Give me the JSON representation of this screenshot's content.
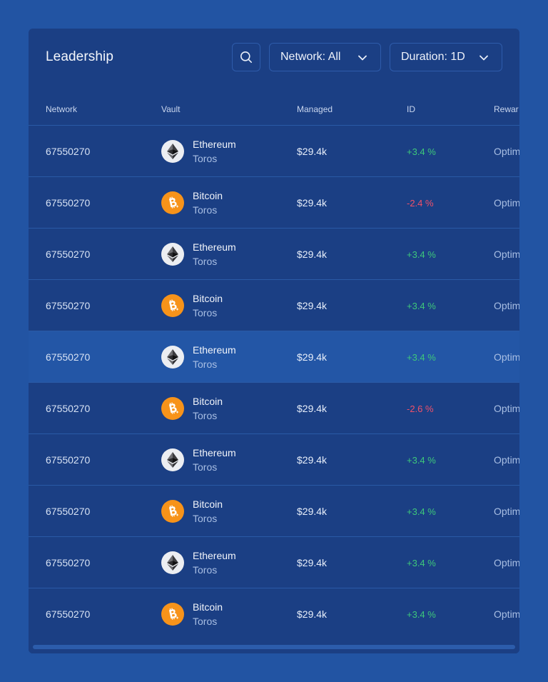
{
  "header": {
    "title": "Leadership",
    "network_filter": "Network: All",
    "duration_filter": "Duration: 1D"
  },
  "table": {
    "columns": [
      "Network",
      "Vault",
      "Managed",
      "ID",
      "Rewar"
    ],
    "rows": [
      {
        "network": "67550270",
        "coin": "eth",
        "name": "Ethereum",
        "sub": "Toros",
        "managed": "$29.4k",
        "change": "+3.4 %",
        "trend": "pos",
        "reward": "Optim"
      },
      {
        "network": "67550270",
        "coin": "btc",
        "name": "Bitcoin",
        "sub": "Toros",
        "managed": "$29.4k",
        "change": "-2.4 %",
        "trend": "neg",
        "reward": "Optim"
      },
      {
        "network": "67550270",
        "coin": "eth",
        "name": "Ethereum",
        "sub": "Toros",
        "managed": "$29.4k",
        "change": "+3.4 %",
        "trend": "pos",
        "reward": "Optim"
      },
      {
        "network": "67550270",
        "coin": "btc",
        "name": "Bitcoin",
        "sub": "Toros",
        "managed": "$29.4k",
        "change": "+3.4 %",
        "trend": "pos",
        "reward": "Optim"
      },
      {
        "network": "67550270",
        "coin": "eth",
        "name": "Ethereum",
        "sub": "Toros",
        "managed": "$29.4k",
        "change": "+3.4 %",
        "trend": "pos",
        "reward": "Optim",
        "highlighted": true
      },
      {
        "network": "67550270",
        "coin": "btc",
        "name": "Bitcoin",
        "sub": "Toros",
        "managed": "$29.4k",
        "change": "-2.6 %",
        "trend": "neg",
        "reward": "Optim"
      },
      {
        "network": "67550270",
        "coin": "eth",
        "name": "Ethereum",
        "sub": "Toros",
        "managed": "$29.4k",
        "change": "+3.4 %",
        "trend": "pos",
        "reward": "Optim"
      },
      {
        "network": "67550270",
        "coin": "btc",
        "name": "Bitcoin",
        "sub": "Toros",
        "managed": "$29.4k",
        "change": "+3.4 %",
        "trend": "pos",
        "reward": "Optim"
      },
      {
        "network": "67550270",
        "coin": "eth",
        "name": "Ethereum",
        "sub": "Toros",
        "managed": "$29.4k",
        "change": "+3.4 %",
        "trend": "pos",
        "reward": "Optim"
      },
      {
        "network": "67550270",
        "coin": "btc",
        "name": "Bitcoin",
        "sub": "Toros",
        "managed": "$29.4k",
        "change": "+3.4 %",
        "trend": "pos",
        "reward": "Optim"
      }
    ]
  },
  "colors": {
    "background": "#2254a3",
    "card": "#1b3f84",
    "row_highlight": "#2356a6",
    "positive": "#3ec87a",
    "negative": "#f0516a",
    "bitcoin": "#f7931a"
  },
  "icons": {
    "search": "search-icon",
    "dropdown": "chevron-down-icon",
    "eth": "ethereum-icon",
    "btc": "bitcoin-icon"
  }
}
